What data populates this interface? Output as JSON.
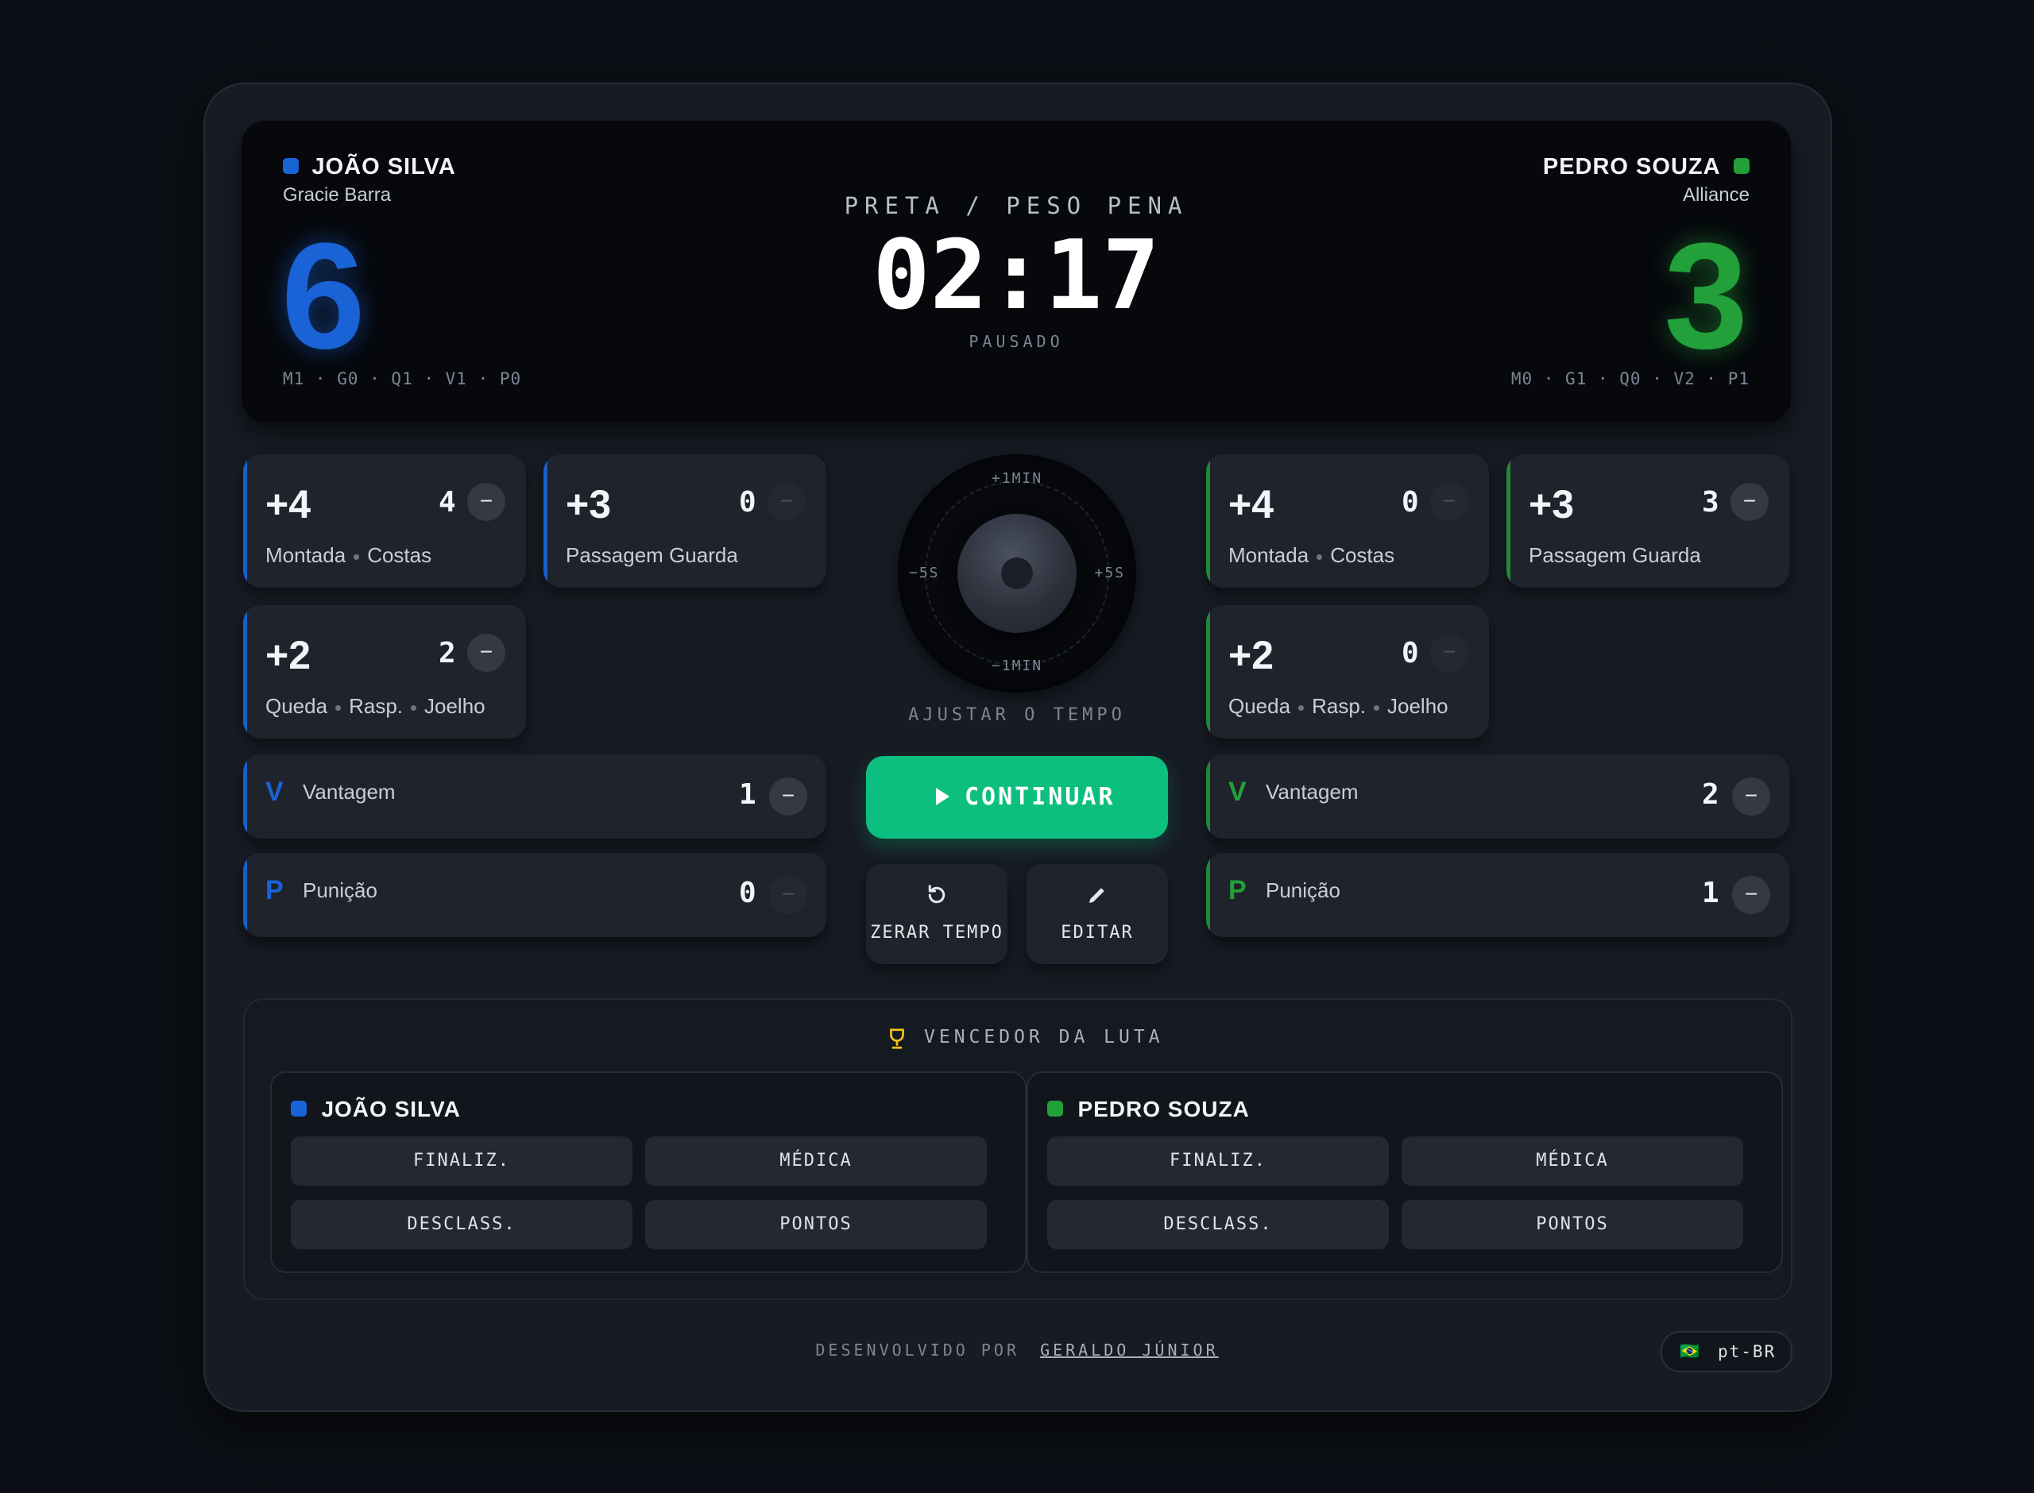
{
  "scoreboard": {
    "left": {
      "name": "JOÃO SILVA",
      "team": "Gracie Barra",
      "score": "6",
      "stats": "M1 · G0 · Q1 · V1 · P0",
      "color": "#1a63d6"
    },
    "right": {
      "name": "PEDRO SOUZA",
      "team": "Alliance",
      "score": "3",
      "stats": "M0 · G1 · Q0 · V2 · P1",
      "color": "#22a03a"
    },
    "category": "PRETA / PESO PENA",
    "timer": "02:17",
    "status": "PAUSADO"
  },
  "left_panel": {
    "mount": {
      "points": "+4",
      "count": "4",
      "labels": [
        "Montada",
        "Costas"
      ]
    },
    "pass": {
      "points": "+3",
      "count": "0",
      "label": "Passagem Guarda"
    },
    "takedown": {
      "points": "+2",
      "count": "2",
      "labels": [
        "Queda",
        "Rasp.",
        "Joelho"
      ]
    },
    "advantage": {
      "letter": "V",
      "label": "Vantagem",
      "count": "1"
    },
    "penalty": {
      "letter": "P",
      "label": "Punição",
      "count": "0"
    }
  },
  "right_panel": {
    "mount": {
      "points": "+4",
      "count": "0",
      "labels": [
        "Montada",
        "Costas"
      ]
    },
    "pass": {
      "points": "+3",
      "count": "3",
      "label": "Passagem Guarda"
    },
    "takedown": {
      "points": "+2",
      "count": "0",
      "labels": [
        "Queda",
        "Rasp.",
        "Joelho"
      ]
    },
    "advantage": {
      "letter": "V",
      "label": "Vantagem",
      "count": "2"
    },
    "penalty": {
      "letter": "P",
      "label": "Punição",
      "count": "1"
    }
  },
  "minus_symbol": "−",
  "dial": {
    "top": "+1MIN",
    "bottom": "−1MIN",
    "left": "−5S",
    "right": "+5S",
    "caption": "AJUSTAR O TEMPO"
  },
  "controls": {
    "continue_label": "CONTINUAR",
    "reset_label": "ZERAR TEMPO",
    "edit_label": "EDITAR"
  },
  "winner": {
    "title": "VENCEDOR DA LUTA",
    "left_name": "JOÃO SILVA",
    "right_name": "PEDRO SOUZA",
    "options": [
      "FINALIZ.",
      "MÉDICA",
      "DESCLASS.",
      "PONTOS"
    ]
  },
  "footer": {
    "developed_by": "DESENVOLVIDO POR",
    "author": "GERALDO JÚNIOR",
    "flag": "🇧🇷",
    "language": "pt-BR"
  },
  "colors": {
    "accent_blue": "#1a63d6",
    "accent_green": "#22a03a",
    "continue_button": "#0dbf7f"
  }
}
